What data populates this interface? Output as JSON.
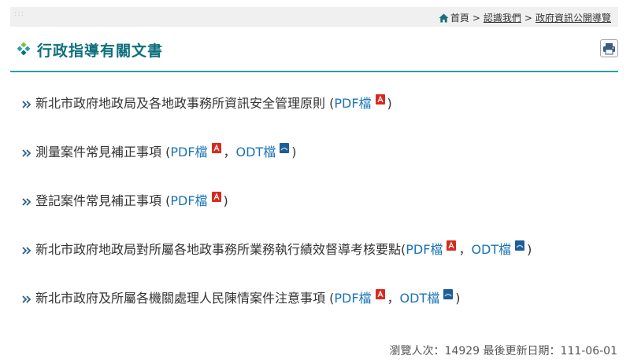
{
  "breadcrumb": {
    "home": "首頁",
    "separator": ">",
    "level1": "認識我們",
    "level2": "政府資訊公開導覽"
  },
  "page": {
    "title": "行政指導有關文書"
  },
  "documents": [
    {
      "title": "新北市政府地政局及各地政事務所資訊安全管理原則 (",
      "pdf_label": "PDF檔",
      "close": ")"
    },
    {
      "title": "測量案件常見補正事項 (",
      "pdf_label": "PDF檔",
      "comma": "，",
      "odt_label": "ODT檔",
      "close": ")"
    },
    {
      "title": "登記案件常見補正事項 (",
      "pdf_label": "PDF檔",
      "close": ")"
    },
    {
      "title": "新北市政府地政局對所屬各地政事務所業務執行績效督導考核要點(",
      "pdf_label": "PDF檔",
      "comma": "，",
      "odt_label": "ODT檔",
      "close": ")"
    },
    {
      "title": "新北市政府及所屬各機關處理人民陳情案件注意事項 (",
      "pdf_label": "PDF檔",
      "comma": "，",
      "odt_label": "ODT檔",
      "close": ")"
    }
  ],
  "footer": {
    "views_label": "瀏覽人次：",
    "views": "14929",
    "updated_label": "最後更新日期：",
    "updated": "111-06-01"
  },
  "colors": {
    "accent": "#0f6f7d",
    "link": "#1a73b8",
    "pdf": "#d52b1e",
    "odt": "#1f5d96"
  },
  "icons": {
    "home": "home-icon",
    "title_marker": "diamond-icon",
    "print": "printer-icon",
    "bullet": "double-chevron-icon",
    "pdf": "pdf-file-icon",
    "odt": "odt-file-icon"
  }
}
